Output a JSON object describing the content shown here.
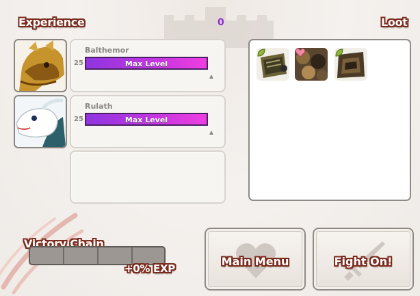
{
  "experience": {
    "title": "Experience",
    "total_exp": "0",
    "dragons": [
      {
        "name": "Balthemor",
        "level": "25",
        "bar_label": "Max Level",
        "progress": 1.0
      },
      {
        "name": "Rulath",
        "level": "25",
        "bar_label": "Max Level",
        "progress": 1.0
      }
    ]
  },
  "loot": {
    "title": "Loot",
    "items": [
      {
        "icon": "tome-item-icon",
        "badge": "leaf-badge-icon"
      },
      {
        "icon": "camo-item-icon",
        "badge": "heart-badge-icon"
      },
      {
        "icon": "scrap-item-icon",
        "badge": "leaf-badge-icon"
      }
    ]
  },
  "victory_chain": {
    "title": "Victory Chain",
    "exp_bonus": "+0% EXP",
    "segments": 4,
    "filled": 0
  },
  "buttons": {
    "main_menu": "Main Menu",
    "fight_on": "Fight On!"
  },
  "colors": {
    "exp_bar_start": "#8e35e0",
    "exp_bar_end": "#ee3ee0",
    "exp_count": "#8e2fd0",
    "title_outline": "#7a2a1c"
  }
}
